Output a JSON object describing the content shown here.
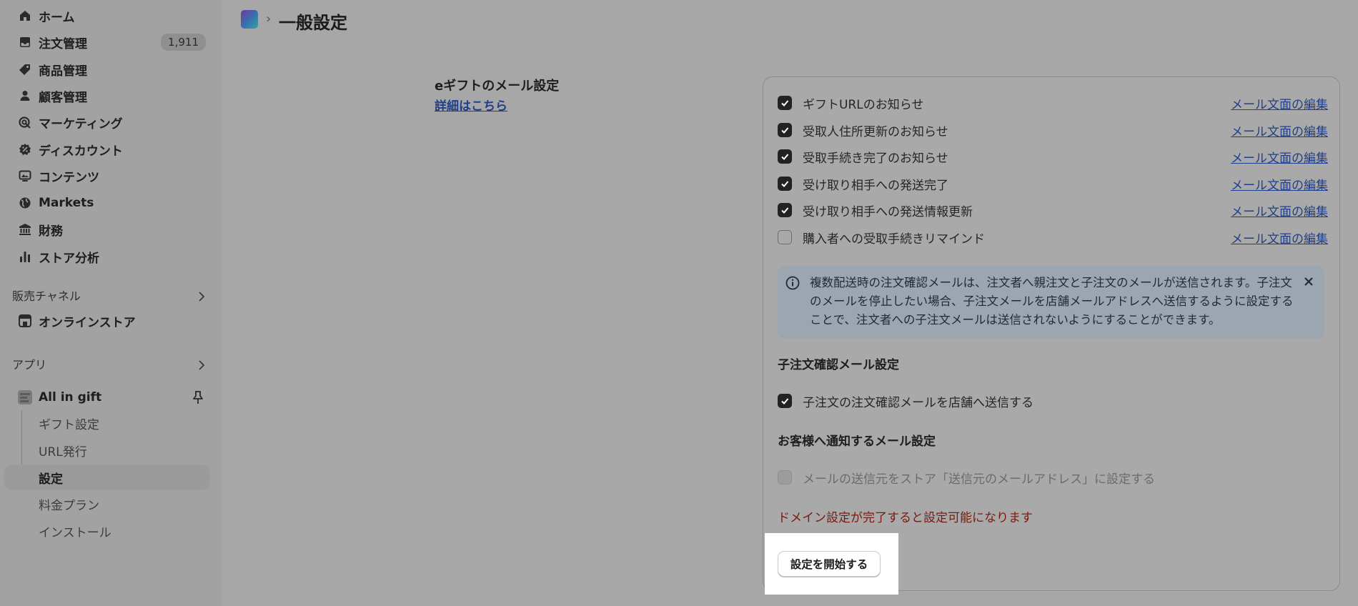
{
  "sidebar": {
    "items": [
      {
        "label": "ホーム",
        "icon": "home-icon"
      },
      {
        "label": "注文管理",
        "icon": "inbox-icon",
        "badge": "1,911"
      },
      {
        "label": "商品管理",
        "icon": "tag-icon"
      },
      {
        "label": "顧客管理",
        "icon": "person-icon"
      },
      {
        "label": "マーケティング",
        "icon": "target-icon"
      },
      {
        "label": "ディスカウント",
        "icon": "discount-icon"
      },
      {
        "label": "コンテンツ",
        "icon": "content-icon"
      },
      {
        "label": "Markets",
        "icon": "globe-icon"
      },
      {
        "label": "財務",
        "icon": "bank-icon"
      },
      {
        "label": "ストア分析",
        "icon": "bar-chart-icon"
      }
    ],
    "sales_channels_label": "販売チャネル",
    "online_store": "オンラインストア",
    "apps_label": "アプリ",
    "app": {
      "name": "All in gift",
      "sub_items": [
        {
          "label": "ギフト設定"
        },
        {
          "label": "URL発行"
        },
        {
          "label": "設定",
          "active": true
        },
        {
          "label": "料金プラン"
        },
        {
          "label": "インストール"
        }
      ]
    }
  },
  "header": {
    "title": "一般設定",
    "separator": "›"
  },
  "section": {
    "title": "eギフトのメール設定",
    "link": "詳細はこちら"
  },
  "notifications": [
    {
      "label": "ギフトURLのお知らせ",
      "checked": true,
      "edit": "メール文面の編集"
    },
    {
      "label": "受取人住所更新のお知らせ",
      "checked": true,
      "edit": "メール文面の編集"
    },
    {
      "label": "受取手続き完了のお知らせ",
      "checked": true,
      "edit": "メール文面の編集"
    },
    {
      "label": "受け取り相手への発送完了",
      "checked": true,
      "edit": "メール文面の編集"
    },
    {
      "label": "受け取り相手への発送情報更新",
      "checked": true,
      "edit": "メール文面の編集"
    },
    {
      "label": "購入者への受取手続きリマインド",
      "checked": false,
      "edit": "メール文面の編集"
    }
  ],
  "banner": {
    "text": "複数配送時の注文確認メールは、注文者へ親注文と子注文のメールが送信されます。子注文のメールを停止したい場合、子注文メールを店舗メールアドレスへ送信するように設定することで、注文者への子注文メールは送信されないようにすることができます。"
  },
  "child_order": {
    "heading": "子注文確認メール設定",
    "checkbox_label": "子注文の注文確認メールを店舗へ送信する",
    "checked": true
  },
  "customer_notify": {
    "heading": "お客様へ通知するメール設定",
    "checkbox_label": "メールの送信元をストア「送信元のメールアドレス」に設定する",
    "checked": false,
    "disabled": true,
    "warning": "ドメイン設定が完了すると設定可能になります",
    "button": "設定を開始する"
  },
  "colors": {
    "link": "#1f3f8c",
    "warning": "#7a1a10",
    "checkbox_on": "#222222"
  }
}
